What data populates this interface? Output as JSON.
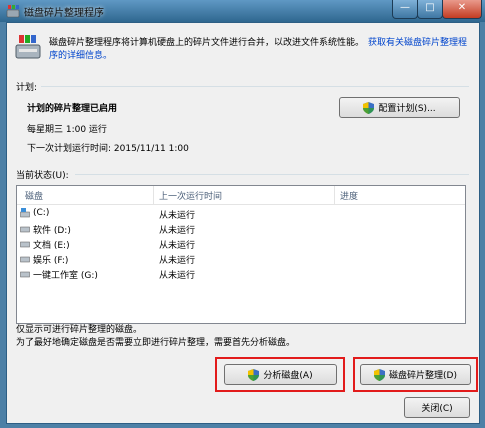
{
  "window": {
    "title": "磁盘碎片整理程序",
    "min_glyph": "—",
    "max_glyph": "□",
    "close_glyph": "✕"
  },
  "intro": {
    "text": "磁盘碎片整理程序将计算机硬盘上的碎片文件进行合并，以改进文件系统性能。",
    "link_part1": "获取有关磁盘碎片整理程",
    "link_part2": "序的详细信息。"
  },
  "schedule": {
    "header": "计划:",
    "status": "计划的碎片整理已启用",
    "frequency": "每星期三  1:00 运行",
    "next_run": "下一次计划运行时间: 2015/11/11 1:00",
    "configure_button": "配置计划(S)..."
  },
  "current_status": {
    "header": "当前状态(U):",
    "columns": [
      "磁盘",
      "上一次运行时间",
      "进度"
    ],
    "rows": [
      {
        "disk": "(C:)",
        "last_run": "从未运行",
        "progress": "",
        "icon": "system-drive-icon"
      },
      {
        "disk": "软件 (D:)",
        "last_run": "从未运行",
        "progress": "",
        "icon": "drive-icon"
      },
      {
        "disk": "文档 (E:)",
        "last_run": "从未运行",
        "progress": "",
        "icon": "drive-icon"
      },
      {
        "disk": "娱乐 (F:)",
        "last_run": "从未运行",
        "progress": "",
        "icon": "drive-icon"
      },
      {
        "disk": "一键工作室 (G:)",
        "last_run": "从未运行",
        "progress": "",
        "icon": "drive-icon"
      }
    ]
  },
  "notes": {
    "line1": "仅显示可进行碎片整理的磁盘。",
    "line2": "为了最好地确定磁盘是否需要立即进行碎片整理，需要首先分析磁盘。"
  },
  "buttons": {
    "analyze": "分析磁盘(A)",
    "defrag": "磁盘碎片整理(D)",
    "close": "关闭(C)"
  },
  "colors": {
    "highlight_box": "#e21b1b",
    "link": "#0044cc"
  }
}
